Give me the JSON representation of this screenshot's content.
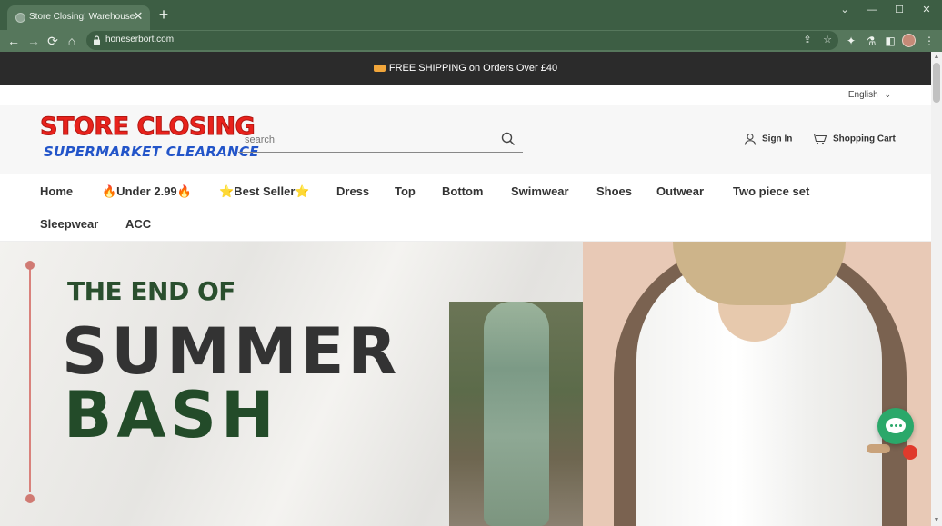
{
  "browser": {
    "tab_title": "Store Closing! Warehouse Clear",
    "tab_close": "✕",
    "new_tab": "+",
    "window_controls": [
      "⌄",
      "—",
      "☐",
      "✕"
    ],
    "url": "honeserbort.com"
  },
  "announcement": {
    "text": "FREE SHIPPING on Orders Over £40"
  },
  "language": {
    "label": "English"
  },
  "logo": {
    "line1": "STORE CLOSING",
    "line2": "SUPERMARKET CLEARANCE"
  },
  "search": {
    "placeholder": "search",
    "value": ""
  },
  "header_links": {
    "sign_in": "Sign In",
    "cart": "Shopping Cart"
  },
  "menu": [
    "Home",
    "🔥Under 2.99🔥",
    "⭐Best Seller⭐",
    "Dress",
    "Top",
    "Bottom",
    "Swimwear",
    "Shoes",
    "Outwear",
    "Two piece set",
    "Sleepwear",
    "ACC"
  ],
  "hero": {
    "line1": "THE END OF",
    "line2": "SUMMER",
    "line3": "BASH"
  },
  "colors": {
    "chrome_dark": "#3d5e44",
    "chrome_light": "#56775c",
    "announce_bg": "#2b2b2b",
    "logo_red": "#e8221c",
    "logo_blue": "#2355c9",
    "hero_green": "#234b29",
    "chat_green": "#2ba86a"
  }
}
